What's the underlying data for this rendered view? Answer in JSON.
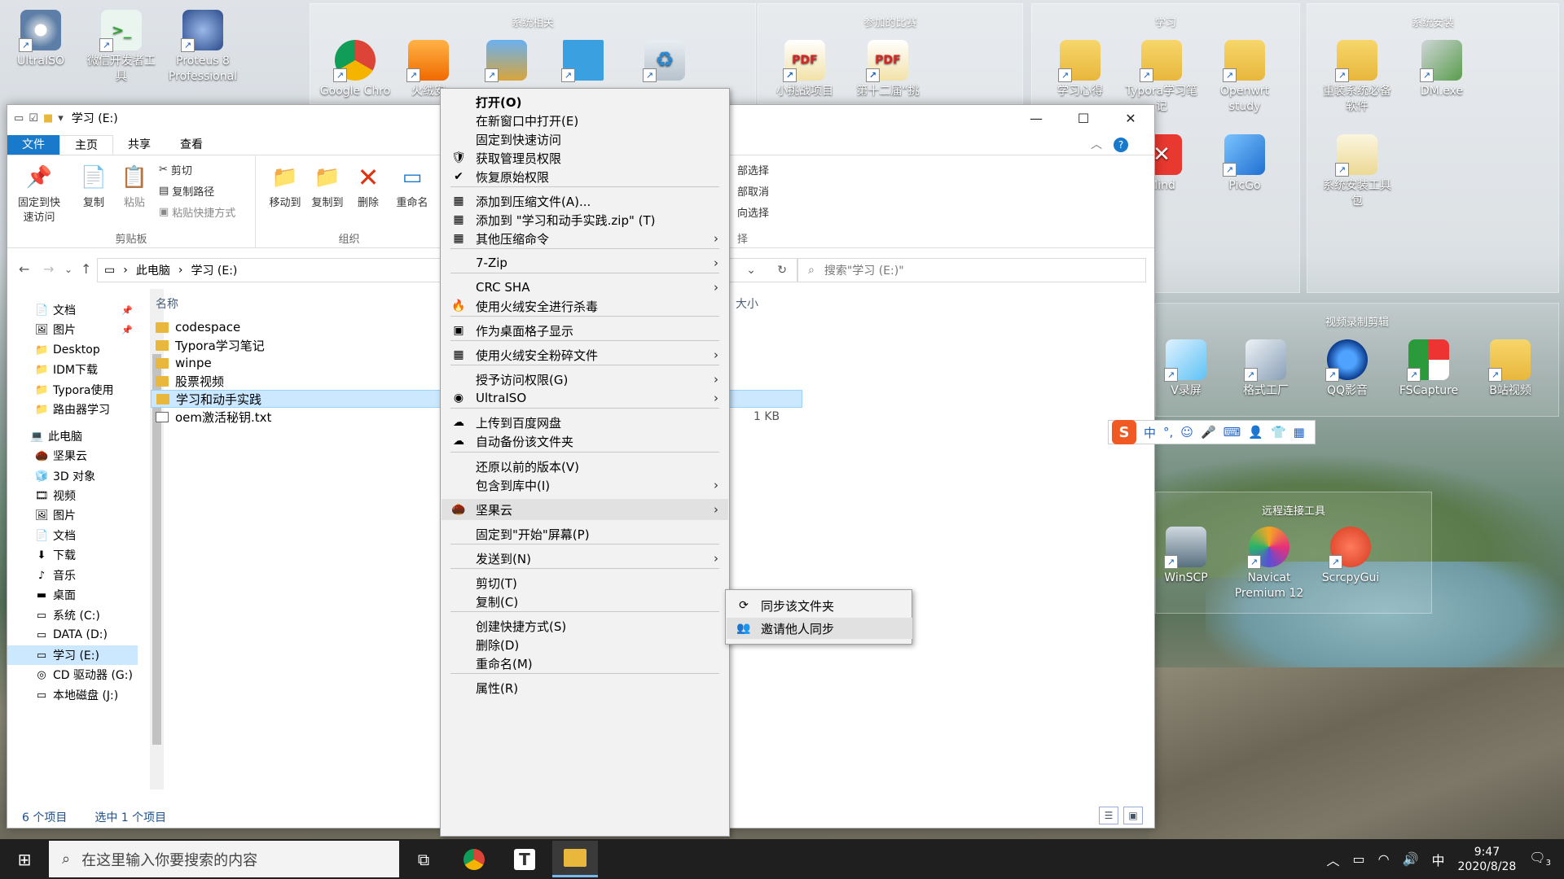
{
  "desktop": {
    "icons_left": [
      {
        "label": "UltraISO",
        "glyph": "💿"
      },
      {
        "label": "微信开发者工具",
        "glyph": ">_"
      },
      {
        "label": "Proteus 8 Professional",
        "glyph": "🌐"
      }
    ],
    "fence_system": {
      "title": "系统相关",
      "icons": [
        "Google Chro",
        "火绒安",
        "",
        "",
        ""
      ]
    },
    "fence_contest": {
      "title": "参加的比赛",
      "icons": [
        "小挑战项目",
        "第十二届“挑"
      ]
    },
    "fence_study": {
      "title": "学习",
      "icons": [
        "学习心得",
        "Typora学习笔记",
        "Openwrt study",
        "Mind",
        "PicGo"
      ]
    },
    "fence_install": {
      "title": "系统安装",
      "icons": [
        "重装系统必备软件",
        "DM.exe",
        "系统安装工具包"
      ]
    },
    "fence_video": {
      "title": "视频录制剪辑",
      "icons": [
        "V录屏",
        "格式工厂",
        "QQ影音",
        "FSCapture",
        "B站视频"
      ]
    },
    "fence_remote": {
      "title": "远程连接工具",
      "icons": [
        "WinSCP",
        "Navicat Premium 12",
        "ScrcpyGui"
      ]
    }
  },
  "explorer": {
    "title": "学习 (E:)",
    "tabs": [
      "文件",
      "主页",
      "共享",
      "查看"
    ],
    "clipboard": {
      "pin_label": "固定到快速访问",
      "copy_label": "复制",
      "paste_label": "粘贴",
      "cut_label": "剪切",
      "copy_path_label": "复制路径",
      "paste_shortcut_label": "粘贴快捷方式",
      "group_label": "剪贴板"
    },
    "organize": {
      "move_label": "移动到",
      "copyto_label": "复制到",
      "delete_label": "删除",
      "rename_label": "重命名",
      "group_label": "组织"
    },
    "select": {
      "all_label": "部选择",
      "none_label": "部取消",
      "invert_label": "向选择",
      "group_label": "择"
    },
    "address": {
      "root": "此电脑",
      "current": "学习 (E:)"
    },
    "search_placeholder": "搜索\"学习 (E:)\"",
    "nav": [
      {
        "label": "文档",
        "icon": "📄",
        "pinned": true
      },
      {
        "label": "图片",
        "icon": "🖼",
        "pinned": true
      },
      {
        "label": "Desktop",
        "icon": "📁"
      },
      {
        "label": "IDM下载",
        "icon": "📁"
      },
      {
        "label": "Typora使用",
        "icon": "📁"
      },
      {
        "label": "路由器学习",
        "icon": "📁"
      },
      {
        "label": "此电脑",
        "icon": "💻"
      },
      {
        "label": "坚果云",
        "icon": "🌰"
      },
      {
        "label": "3D 对象",
        "icon": "🧊"
      },
      {
        "label": "视频",
        "icon": "🎞"
      },
      {
        "label": "图片",
        "icon": "🖼"
      },
      {
        "label": "文档",
        "icon": "📄"
      },
      {
        "label": "下载",
        "icon": "⬇"
      },
      {
        "label": "音乐",
        "icon": "♪"
      },
      {
        "label": "桌面",
        "icon": "▬"
      },
      {
        "label": "系统 (C:)",
        "icon": "▭"
      },
      {
        "label": "DATA (D:)",
        "icon": "▭"
      },
      {
        "label": "学习 (E:)",
        "icon": "▭",
        "selected": true
      },
      {
        "label": "CD 驱动器 (G:)",
        "icon": "◎"
      },
      {
        "label": "本地磁盘 (J:)",
        "icon": "▭"
      }
    ],
    "columns": {
      "name": "名称",
      "size": "大小"
    },
    "files": [
      {
        "name": "codespace",
        "type": "folder"
      },
      {
        "name": "Typora学习笔记",
        "type": "folder"
      },
      {
        "name": "winpe",
        "type": "folder"
      },
      {
        "name": "股票视频",
        "type": "folder"
      },
      {
        "name": "学习和动手实践",
        "type": "folder",
        "selected": true
      },
      {
        "name": "oem激活秘钥.txt",
        "type": "txt",
        "size": "1 KB"
      }
    ],
    "status": {
      "count": "6 个项目",
      "selected": "选中 1 个项目"
    }
  },
  "context_menu": {
    "items": [
      {
        "label": "打开(O)",
        "bold": true
      },
      {
        "label": "在新窗口中打开(E)"
      },
      {
        "label": "固定到快速访问"
      },
      {
        "label": "获取管理员权限",
        "icon": "🛡"
      },
      {
        "label": "恢复原始权限",
        "icon": "✔"
      },
      {
        "label": "添加到压缩文件(A)...",
        "icon": "▦"
      },
      {
        "label": "添加到 \"学习和动手实践.zip\" (T)",
        "icon": "▦"
      },
      {
        "label": "其他压缩命令",
        "icon": "▦",
        "submenu": true
      },
      {
        "label": "7-Zip",
        "submenu": true
      },
      {
        "label": "CRC SHA",
        "submenu": true
      },
      {
        "label": "使用火绒安全进行杀毒",
        "icon": "🔥"
      },
      {
        "label": "作为桌面格子显示",
        "icon": "▣"
      },
      {
        "label": "使用火绒安全粉碎文件",
        "icon": "▦",
        "submenu": true
      },
      {
        "label": "授予访问权限(G)",
        "submenu": true
      },
      {
        "label": "UltraISO",
        "icon": "◉",
        "submenu": true
      },
      {
        "label": "上传到百度网盘",
        "icon": "☁"
      },
      {
        "label": "自动备份该文件夹",
        "icon": "☁"
      },
      {
        "label": "还原以前的版本(V)"
      },
      {
        "label": "包含到库中(I)",
        "submenu": true
      },
      {
        "label": "坚果云",
        "icon": "🌰",
        "submenu": true,
        "highlighted": true
      },
      {
        "label": "固定到\"开始\"屏幕(P)"
      },
      {
        "label": "发送到(N)",
        "submenu": true
      },
      {
        "label": "剪切(T)"
      },
      {
        "label": "复制(C)"
      },
      {
        "label": "创建快捷方式(S)"
      },
      {
        "label": "删除(D)"
      },
      {
        "label": "重命名(M)"
      },
      {
        "label": "属性(R)"
      }
    ],
    "submenu": [
      {
        "label": "同步该文件夹",
        "icon": "⟳"
      },
      {
        "label": "邀请他人同步",
        "icon": "👥"
      }
    ]
  },
  "ime": {
    "logo": "S",
    "mode": "中",
    "punct": "°,"
  },
  "taskbar": {
    "search_placeholder": "在这里输入你要搜索的内容",
    "time": "9:47",
    "date": "2020/8/28",
    "ime_indicator": "中",
    "notifications": "3"
  }
}
